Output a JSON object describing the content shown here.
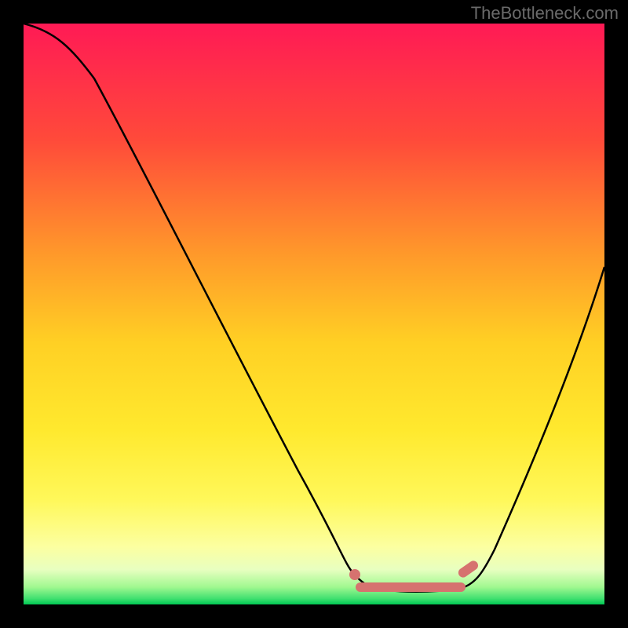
{
  "watermark": "TheBottleneck.com",
  "chart_data": {
    "type": "line",
    "title": "",
    "xlabel": "",
    "ylabel": "",
    "xlim": [
      0,
      100
    ],
    "ylim": [
      0,
      100
    ],
    "grid": false,
    "series": [
      {
        "name": "curve",
        "x": [
          0,
          5,
          10,
          15,
          20,
          25,
          30,
          35,
          40,
          45,
          50,
          53,
          56,
          60,
          65,
          70,
          75,
          80,
          85,
          90,
          95,
          100
        ],
        "values": [
          100,
          99,
          95,
          89,
          80,
          70,
          59,
          48,
          37,
          26,
          16,
          10,
          5,
          3,
          2,
          2,
          4,
          10,
          20,
          32,
          45,
          58
        ]
      }
    ],
    "highlight": {
      "name": "optimal-range",
      "x_start": 56,
      "x_end": 78,
      "y": 3,
      "color": "#d6726f"
    },
    "background_gradient_stops": [
      {
        "pos": 0,
        "color": "#ff1a55"
      },
      {
        "pos": 20,
        "color": "#ff4a3a"
      },
      {
        "pos": 40,
        "color": "#ff9a2a"
      },
      {
        "pos": 55,
        "color": "#ffd024"
      },
      {
        "pos": 70,
        "color": "#ffe92e"
      },
      {
        "pos": 82,
        "color": "#fff85a"
      },
      {
        "pos": 90,
        "color": "#fcffa0"
      },
      {
        "pos": 94,
        "color": "#e8ffc0"
      },
      {
        "pos": 97,
        "color": "#a0f890"
      },
      {
        "pos": 99,
        "color": "#40e070"
      },
      {
        "pos": 100,
        "color": "#00c853"
      }
    ]
  }
}
